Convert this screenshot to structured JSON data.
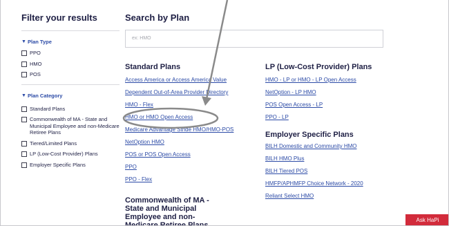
{
  "sidebar": {
    "title": "Filter your results",
    "groups": [
      {
        "label": "Plan Type",
        "options": [
          "PPO",
          "HMO",
          "POS"
        ]
      },
      {
        "label": "Plan Category",
        "options": [
          "Standard Plans",
          "Commonwealth of MA - State and Municipal Employee and non-Medicare Retiree Plans",
          "Tiered/Limited Plans",
          "LP (Low-Cost Provider) Plans",
          "Employer Specific Plans"
        ]
      }
    ]
  },
  "main": {
    "title": "Search by Plan",
    "search_placeholder": "ex: HMO",
    "standard": {
      "heading": "Standard Plans",
      "links": [
        "Access America or Access America Value",
        "Dependent Out-of-Area Provider Directory",
        "HMO - Flex",
        "HMO or HMO Open Access",
        "Medicare Advantage Stride HMO/HMO-POS",
        "NetOption HMO",
        "POS or POS Open Access",
        "PPO",
        "PPO - Flex"
      ]
    },
    "commonwealth_heading": "Commonwealth of MA - State and Municipal Employee and non-Medicare Retiree Plans",
    "lp": {
      "heading": "LP (Low-Cost Provider) Plans",
      "links": [
        "HMO - LP or HMO - LP Open Access",
        "NetOption - LP HMO",
        "POS Open Access - LP",
        "PPO - LP"
      ]
    },
    "employer": {
      "heading": "Employer Specific Plans",
      "links": [
        "BILH Domestic and Community HMO",
        "BILH HMO Plus",
        "BILH Tiered POS",
        "HMFP/APHMFP Choice Network - 2020",
        "Reliant Select HMO"
      ]
    }
  },
  "chat_button": "Ask HaPi",
  "colors": {
    "link": "#2b4aa6",
    "heading": "#1e1f44",
    "chat": "#d22b3b",
    "annotation": "#8a8a8a"
  }
}
